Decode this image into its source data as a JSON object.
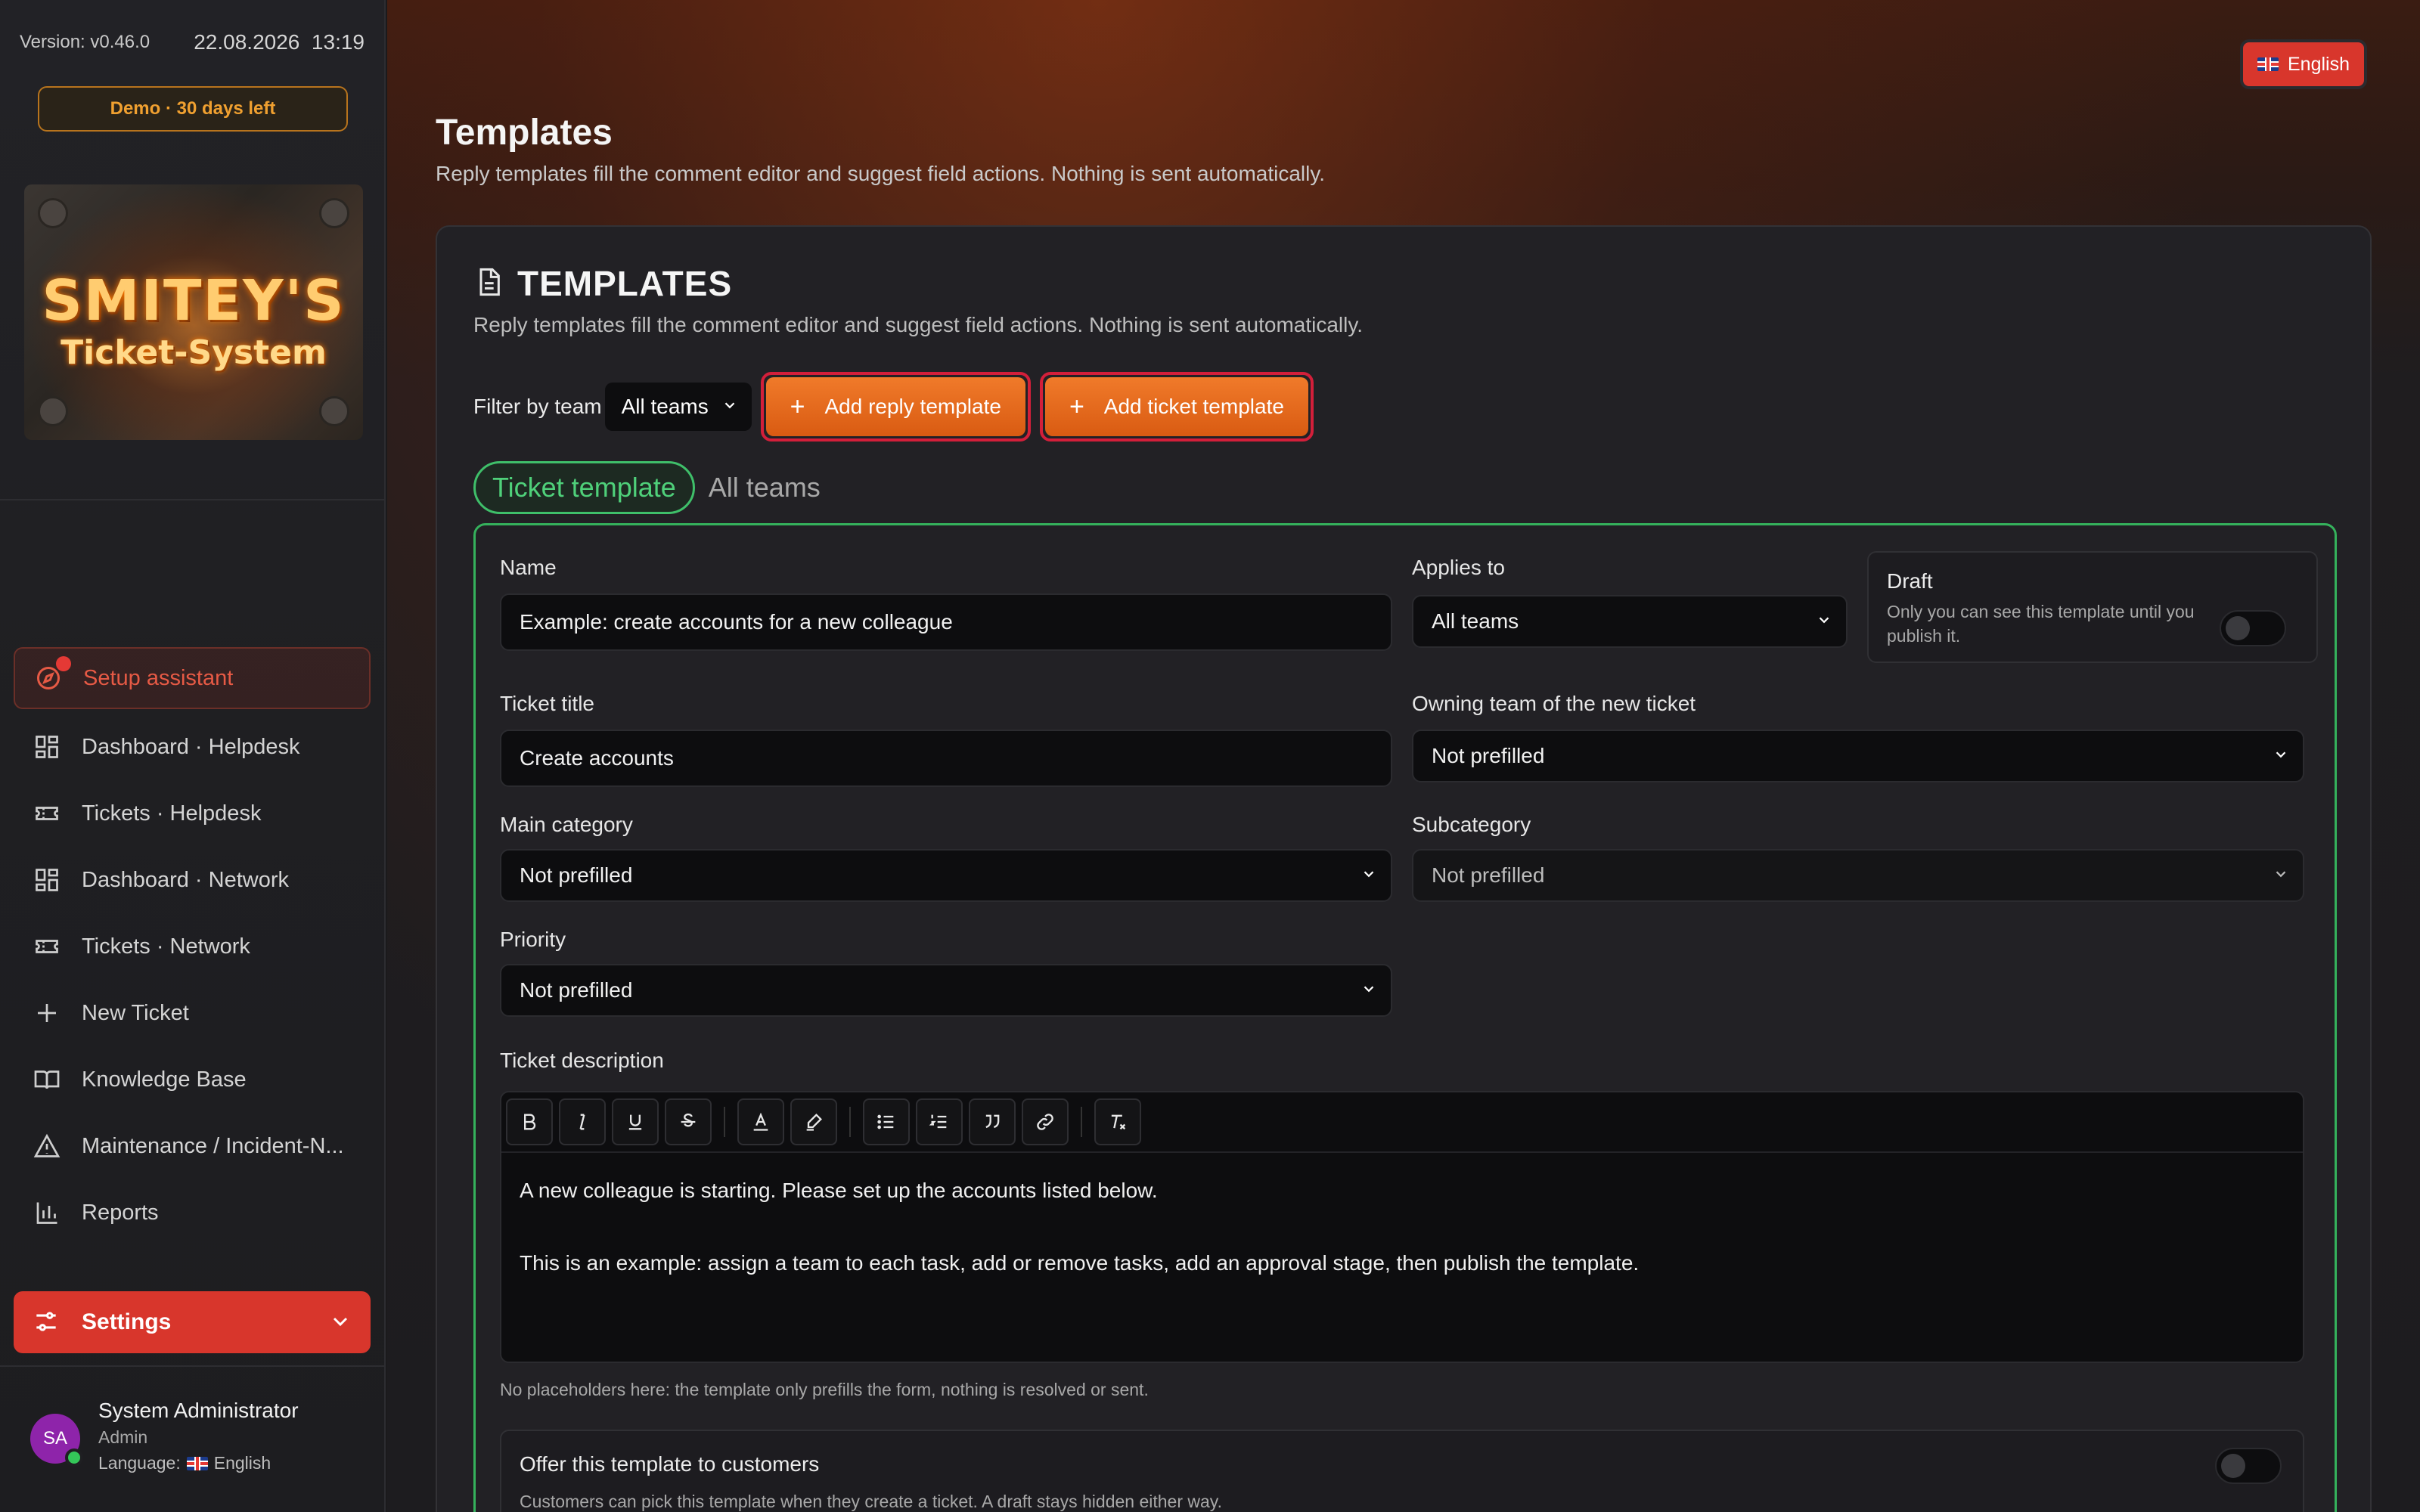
{
  "sidebar": {
    "version": "Version: v0.46.0",
    "date": "22.08.2026",
    "time": "13:19",
    "demo_badge": "Demo · 30 days left",
    "logo": {
      "line1": "SMITEY'S",
      "line2": "Ticket-System"
    },
    "nav": [
      {
        "label": "Setup assistant",
        "icon": "compass-icon"
      },
      {
        "label": "Dashboard · Helpdesk",
        "icon": "dashboard-icon"
      },
      {
        "label": "Tickets · Helpdesk",
        "icon": "ticket-icon"
      },
      {
        "label": "Dashboard · Network",
        "icon": "dashboard-icon"
      },
      {
        "label": "Tickets · Network",
        "icon": "ticket-icon"
      },
      {
        "label": "New Ticket",
        "icon": "plus-icon"
      },
      {
        "label": "Knowledge Base",
        "icon": "book-icon"
      },
      {
        "label": "Maintenance / Incident-N...",
        "icon": "warning-icon"
      },
      {
        "label": "Reports",
        "icon": "bar-chart-icon"
      }
    ],
    "settings_label": "Settings",
    "user": {
      "initials": "SA",
      "name": "System Administrator",
      "role": "Admin",
      "language_label": "Language:",
      "language": "English"
    }
  },
  "header": {
    "language_button": "English",
    "title": "Templates",
    "subtitle": "Reply templates fill the comment editor and suggest field actions. Nothing is sent automatically."
  },
  "card": {
    "title": "TEMPLATES",
    "subtitle": "Reply templates fill the comment editor and suggest field actions. Nothing is sent automatically.",
    "filter_label": "Filter by team",
    "filter_value": "All teams",
    "add_reply": "Add reply template",
    "add_ticket": "Add ticket template",
    "tab_active": "Ticket template",
    "tab_other": "All teams"
  },
  "form": {
    "name_label": "Name",
    "name_value": "Example: create accounts for a new colleague",
    "applies_label": "Applies to",
    "applies_value": "All teams",
    "draft_title": "Draft",
    "draft_desc": "Only you can see this template until you publish it.",
    "ticket_title_label": "Ticket title",
    "ticket_title_value": "Create accounts",
    "owning_team_label": "Owning team of the new ticket",
    "owning_team_value": "Not prefilled",
    "main_category_label": "Main category",
    "main_category_value": "Not prefilled",
    "subcategory_label": "Subcategory",
    "subcategory_value": "Not prefilled",
    "priority_label": "Priority",
    "priority_value": "Not prefilled",
    "description_label": "Ticket description",
    "description_line1": "A new colleague is starting. Please set up the accounts listed below.",
    "description_line2": "This is an example: assign a team to each task, add or remove tasks, add an approval stage, then publish the template.",
    "note": "No placeholders here: the template only prefills the form, nothing is resolved or sent.",
    "offer_title": "Offer this template to customers",
    "offer_desc": "Customers can pick this template when they create a ticket. A draft stays hidden either way."
  },
  "colors": {
    "accent_red": "#d8362c",
    "accent_orange": "#e86a1e",
    "accent_green": "#3fbf6a"
  }
}
